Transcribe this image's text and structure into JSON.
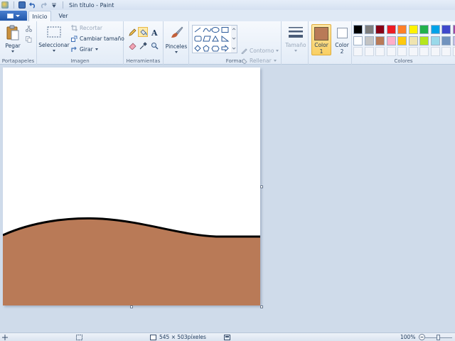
{
  "window": {
    "title": "Sin título - Paint"
  },
  "tabs": [
    {
      "label": "Inicio",
      "active": true
    },
    {
      "label": "Ver",
      "active": false
    }
  ],
  "ribbon": {
    "clipboard": {
      "label": "Portapapeles",
      "paste": "Pegar"
    },
    "image": {
      "label": "Imagen",
      "select": "Seleccionar",
      "crop": "Recortar",
      "resize": "Cambiar tamaño",
      "rotate": "Girar"
    },
    "tools": {
      "label": "Herramientas",
      "items": [
        "pencil-icon",
        "fill-icon",
        "text-icon",
        "eraser-icon",
        "color-picker-icon",
        "magnifier-icon"
      ],
      "selected": "fill-icon"
    },
    "brushes": {
      "label": "Pinceles"
    },
    "shapes": {
      "label": "Formas",
      "outline": "Contorno",
      "fill": "Rellenar"
    },
    "size": {
      "label": "Tamaño"
    },
    "color1": {
      "label": "Color",
      "number": "1",
      "value": "#b97a57"
    },
    "color2": {
      "label": "Color",
      "number": "2",
      "value": "#ffffff"
    },
    "colors": {
      "label": "Colores",
      "row1": [
        "#000000",
        "#7f7f7f",
        "#880015",
        "#ed1c24",
        "#ff7f27",
        "#fff200",
        "#22b14c",
        "#00a2e8",
        "#3f48cc",
        "#a349a4"
      ],
      "row2": [
        "#ffffff",
        "#c3c3c3",
        "#b97a57",
        "#ffaec9",
        "#ffc90e",
        "#efe4b0",
        "#b5e61d",
        "#99d9ea",
        "#7092be",
        "#c8bfe7"
      ]
    }
  },
  "canvas": {
    "fill_color": "#b97a57",
    "stroke_color": "#000000"
  },
  "statusbar": {
    "dimensions": "545 × 503píxeles",
    "zoom": "100%"
  }
}
